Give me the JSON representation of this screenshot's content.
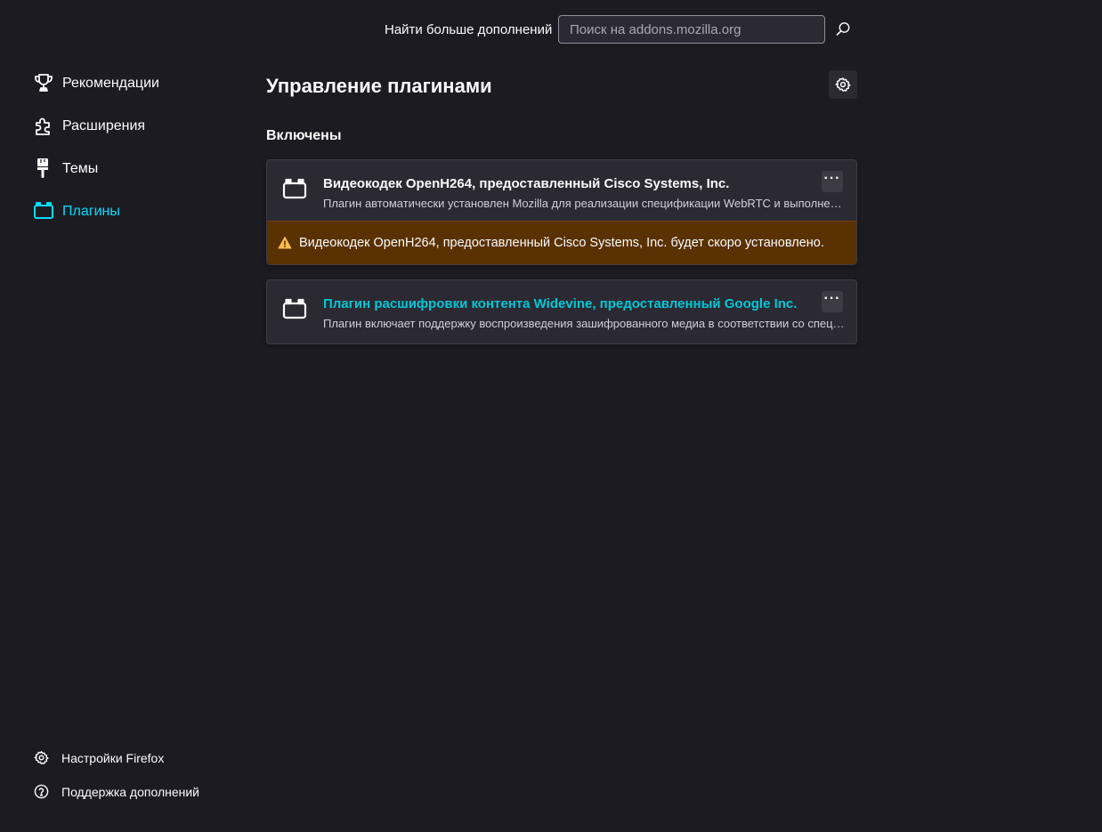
{
  "search": {
    "label": "Найти больше дополнений",
    "placeholder": "Поиск на addons.mozilla.org"
  },
  "sidebar": {
    "items": [
      {
        "label": "Рекомендации",
        "icon": "trophy-icon"
      },
      {
        "label": "Расширения",
        "icon": "puzzle-piece-icon"
      },
      {
        "label": "Темы",
        "icon": "paintbrush-icon"
      },
      {
        "label": "Плагины",
        "icon": "plugin-icon",
        "active": true
      }
    ],
    "footer": [
      {
        "label": "Настройки Firefox",
        "icon": "gear-icon"
      },
      {
        "label": "Поддержка дополнений",
        "icon": "help-icon"
      }
    ]
  },
  "main": {
    "title": "Управление плагинами",
    "section_heading": "Включены",
    "plugins": [
      {
        "name": "Видеокодек OpenH264, предоставленный Cisco Systems, Inc.",
        "description": "Плагин автоматически установлен Mozilla для реализации спецификации WebRTC и выполнения вызовов WebRTC с устройствами, которым требуется видеокодек H.264.",
        "warning": "Видеокодек OpenH264, предоставленный Cisco Systems, Inc. будет скоро установлено."
      },
      {
        "name": "Плагин расшифровки контента Widevine, предоставленный Google Inc.",
        "description": "Плагин включает поддержку воспроизведения зашифрованного медиа в соответствии со спецификацией Encrypted Media Extensions."
      }
    ]
  },
  "colors": {
    "background": "#1c1b22",
    "card": "#2b2a33",
    "accent": "#00ddff",
    "warning_bg": "#5a3100",
    "warning_icon": "#ffbd4f"
  }
}
